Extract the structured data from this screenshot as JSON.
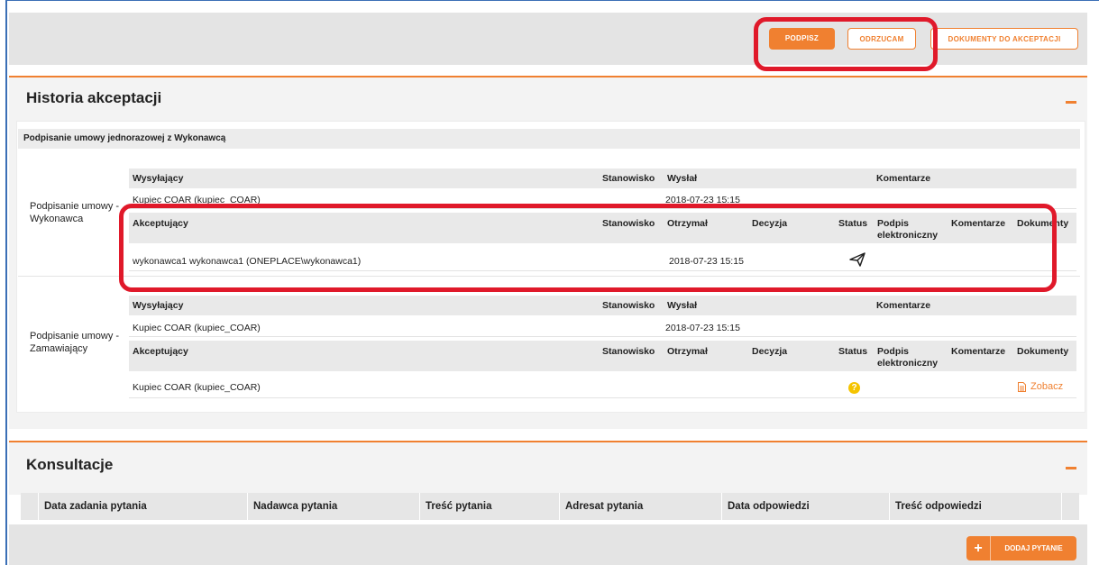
{
  "toolbar": {
    "sign_label": "PODPISZ",
    "reject_label": "ODRZUCAM",
    "docs_label": "DOKUMENTY DO AKCEPTACJI"
  },
  "history": {
    "title": "Historia akceptacji",
    "group_title": "Podpisanie umowy jednorazowej z Wykonawcą",
    "sender_headers": {
      "sender": "Wysyłający",
      "position": "Stanowisko",
      "sent": "Wysłał",
      "comments": "Komentarze"
    },
    "acceptor_headers": {
      "acceptor": "Akceptujący",
      "position": "Stanowisko",
      "received": "Otrzymał",
      "decision": "Decyzja",
      "status": "Status",
      "signature": "Podpis elektroniczny",
      "comments": "Komentarze",
      "documents": "Dokumenty"
    },
    "steps": [
      {
        "name": "Podpisanie umowy - Wykonawca",
        "sender": "Kupiec COAR (kupiec_COAR)",
        "sent": "2018-07-23 15:15",
        "acceptor": "wykonawca1 wykonawca1 (ONEPLACE\\wykonawca1)",
        "received": "2018-07-23 15:15",
        "status_icon": "paper-plane-icon"
      },
      {
        "name": "Podpisanie umowy - Zamawiający",
        "sender": "Kupiec COAR (kupiec_COAR)",
        "sent": "2018-07-23 15:15",
        "acceptor": "Kupiec COAR (kupiec_COAR)",
        "received": "",
        "status_icon": "question-icon",
        "document_link": "Zobacz"
      }
    ]
  },
  "consultations": {
    "title": "Konsultacje",
    "columns": [
      "Data zadania pytania",
      "Nadawca pytania",
      "Treść pytania",
      "Adresat pytania",
      "Data odpowiedzi",
      "Treść odpowiedzi"
    ],
    "add_label": "DODAJ PYTANIE"
  },
  "colors": {
    "accent": "#f08030",
    "highlight": "#e0192a",
    "status_pending": "#f5c400"
  }
}
